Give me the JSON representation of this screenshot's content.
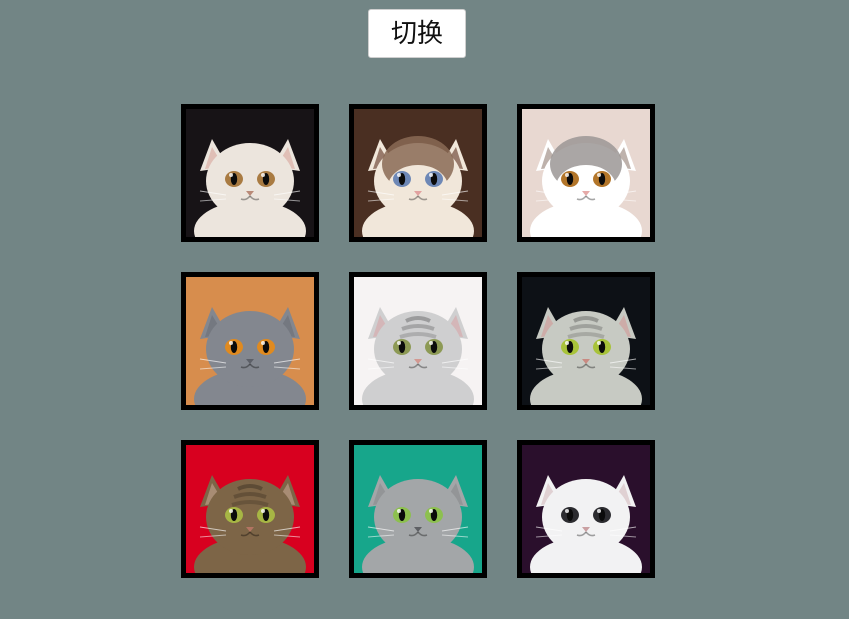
{
  "toolbar": {
    "switch_label": "切换"
  },
  "gallery": {
    "items": [
      {
        "name": "cat-photo-1",
        "bg": "#171316",
        "fur": "#ece5dd",
        "ear_inner": "#dcb2a8",
        "eye": "#a97b42",
        "nose": "#b98a78",
        "stripes": false
      },
      {
        "name": "cat-photo-2",
        "bg": "#4a2f22",
        "fur": "#f1e7da",
        "ear_inner": "#7a5646",
        "eye": "#6e88b6",
        "nose": "#e2a2a0",
        "stripes": false,
        "mask": "#8a6a55"
      },
      {
        "name": "cat-photo-3",
        "bg": "#e8d8d1",
        "fur": "#ffffff",
        "ear_inner": "#a89890",
        "eye": "#b3762a",
        "nose": "#e6aaa8",
        "stripes": false,
        "mask": "#9b9795"
      },
      {
        "name": "cat-photo-4",
        "bg": "#d78d4d",
        "fur": "#83878f",
        "ear_inner": "#6f737b",
        "eye": "#e08a1f",
        "nose": "#5d6068",
        "stripes": false
      },
      {
        "name": "cat-photo-5",
        "bg": "#f6f3f3",
        "fur": "#cfcfd0",
        "ear_inner": "#d5aeb0",
        "eye": "#8d9a55",
        "nose": "#d39891",
        "stripes": true
      },
      {
        "name": "cat-photo-6",
        "bg": "#0d1116",
        "fur": "#c7cac3",
        "ear_inner": "#cfa19f",
        "eye": "#a8c33a",
        "nose": "#c98a82",
        "stripes": true
      },
      {
        "name": "cat-photo-7",
        "bg": "#d8001f",
        "fur": "#7d6547",
        "ear_inner": "#b79a83",
        "eye": "#a7b644",
        "nose": "#b37462",
        "stripes": true
      },
      {
        "name": "cat-photo-8",
        "bg": "#17a68b",
        "fur": "#a3a6a8",
        "ear_inner": "#8d8f91",
        "eye": "#8dc04f",
        "nose": "#5e6064",
        "stripes": false
      },
      {
        "name": "cat-photo-9",
        "bg": "#2a0f2c",
        "fur": "#f2f2f3",
        "ear_inner": "#d9c6c8",
        "eye": "#2c2c30",
        "nose": "#caa0a2",
        "stripes": false
      }
    ]
  }
}
